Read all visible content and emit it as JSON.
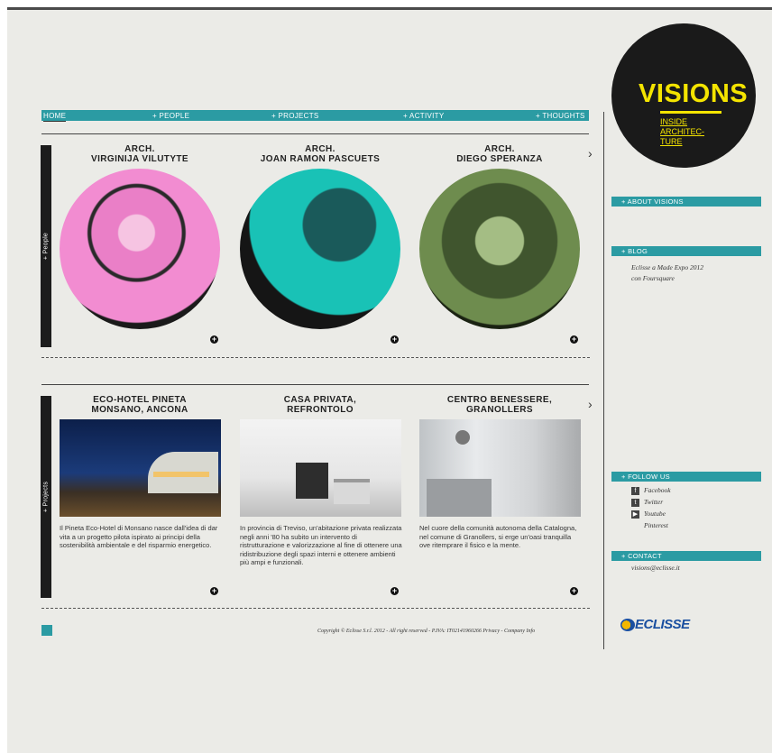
{
  "nav": {
    "home": "Home",
    "people": "+ People",
    "projects": "+ Projects",
    "activity": "+ Activity",
    "thoughts": "+ Thoughts"
  },
  "people_section": {
    "label": "+ People",
    "cards": [
      {
        "title1": "Arch.",
        "title2": "Virginija Vilutyte"
      },
      {
        "title1": "Arch.",
        "title2": "Joan Ramon Pascuets"
      },
      {
        "title1": "Arch.",
        "title2": "Diego Speranza"
      }
    ]
  },
  "projects_section": {
    "label": "+ Projects",
    "cards": [
      {
        "title1": "Eco-Hotel Pineta",
        "title2": "Monsano, Ancona",
        "desc": "Il Pineta Eco-Hotel di Monsano nasce dall'idea di dar vita a un progetto pilota ispirato ai principi della sostenibilità ambientale e del risparmio energetico."
      },
      {
        "title1": "Casa privata,",
        "title2": "Refrontolo",
        "desc": "In provincia di Treviso, un'abitazione privata realizzata negli anni '80 ha subito un intervento di ristrutturazione e valorizzazione al fine di ottenere una ridistribuzione degli spazi interni e ottenere ambienti più ampi e funzionali."
      },
      {
        "title1": "Centro benessere,",
        "title2": "Granollers",
        "desc": "Nel cuore della comunità autonoma della Catalogna, nel comune di Granollers, si erge un'oasi tranquilla ove ritemprare il fisico e la mente."
      }
    ]
  },
  "logo": {
    "word": "Visions",
    "line1": "Inside",
    "line2": "Architec-",
    "line3": "ture"
  },
  "sidebar": {
    "about": "+ About Visions",
    "blog": "+ Blog",
    "blog_link": "Eclisse a Made Expo 2012 con Foursquare",
    "follow": "+ Follow us",
    "facebook": "Facebook",
    "twitter": "Twitter",
    "youtube": "Youtube",
    "pinterest": "Pinterest",
    "contact": "+ Contact",
    "email": "visions@eclisse.it"
  },
  "brand": {
    "name": "ECLISSE",
    "accent": "#2b9ba3",
    "logo_yellow": "#f4e400"
  },
  "footer": {
    "copyright": "Copyright © Eclisse S.r.l. 2012 - All right reserved - P.IVA: IT02141960266  Privacy - Company Info"
  },
  "icons": {
    "plus": "plus-circle-icon",
    "arrow": "chevron-right-icon",
    "facebook": "facebook-icon",
    "twitter": "twitter-icon",
    "youtube": "youtube-icon"
  }
}
